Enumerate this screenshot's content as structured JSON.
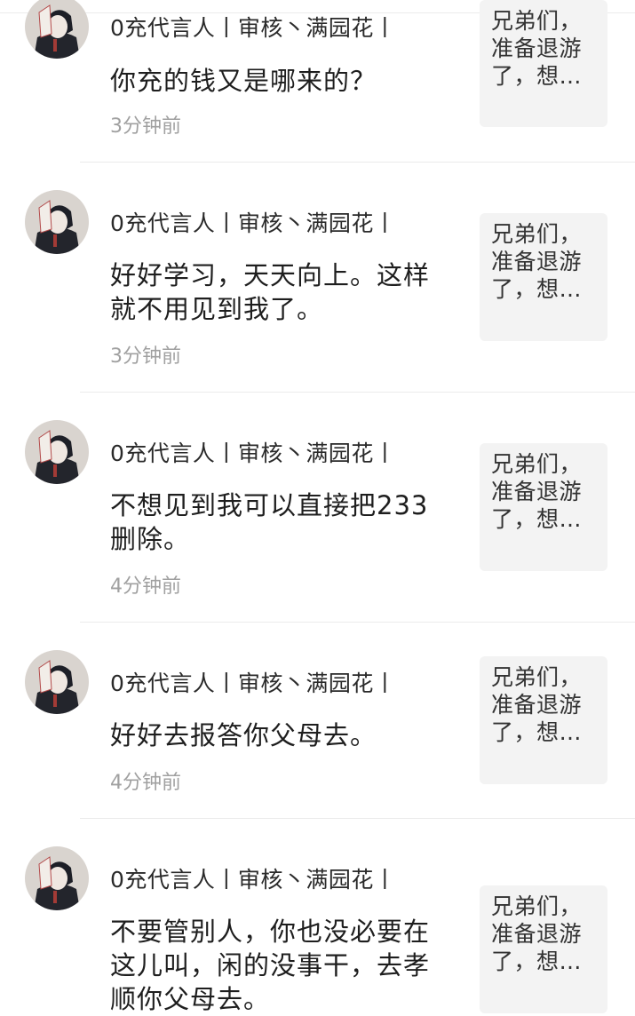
{
  "comments": [
    {
      "user": "0充代言人丨审核丶满园花丨",
      "text": "你充的钱又是哪来的？",
      "time": "3分钟前",
      "ref": "兄弟们，准备退游了，想…"
    },
    {
      "user": "0充代言人丨审核丶满园花丨",
      "text": "好好学习，天天向上。这样就不用见到我了。",
      "time": "3分钟前",
      "ref": "兄弟们，准备退游了，想…"
    },
    {
      "user": "0充代言人丨审核丶满园花丨",
      "text": "不想见到我可以直接把233删除。",
      "time": "4分钟前",
      "ref": "兄弟们，准备退游了，想…"
    },
    {
      "user": "0充代言人丨审核丶满园花丨",
      "text": "好好去报答你父母去。",
      "time": "4分钟前",
      "ref": "兄弟们，准备退游了，想…"
    },
    {
      "user": "0充代言人丨审核丶满园花丨",
      "text": "不要管别人，你也没必要在这儿叫，闲的没事干，去孝顺你父母去。",
      "time": "",
      "ref": "兄弟们，准备退游了，想…"
    }
  ]
}
